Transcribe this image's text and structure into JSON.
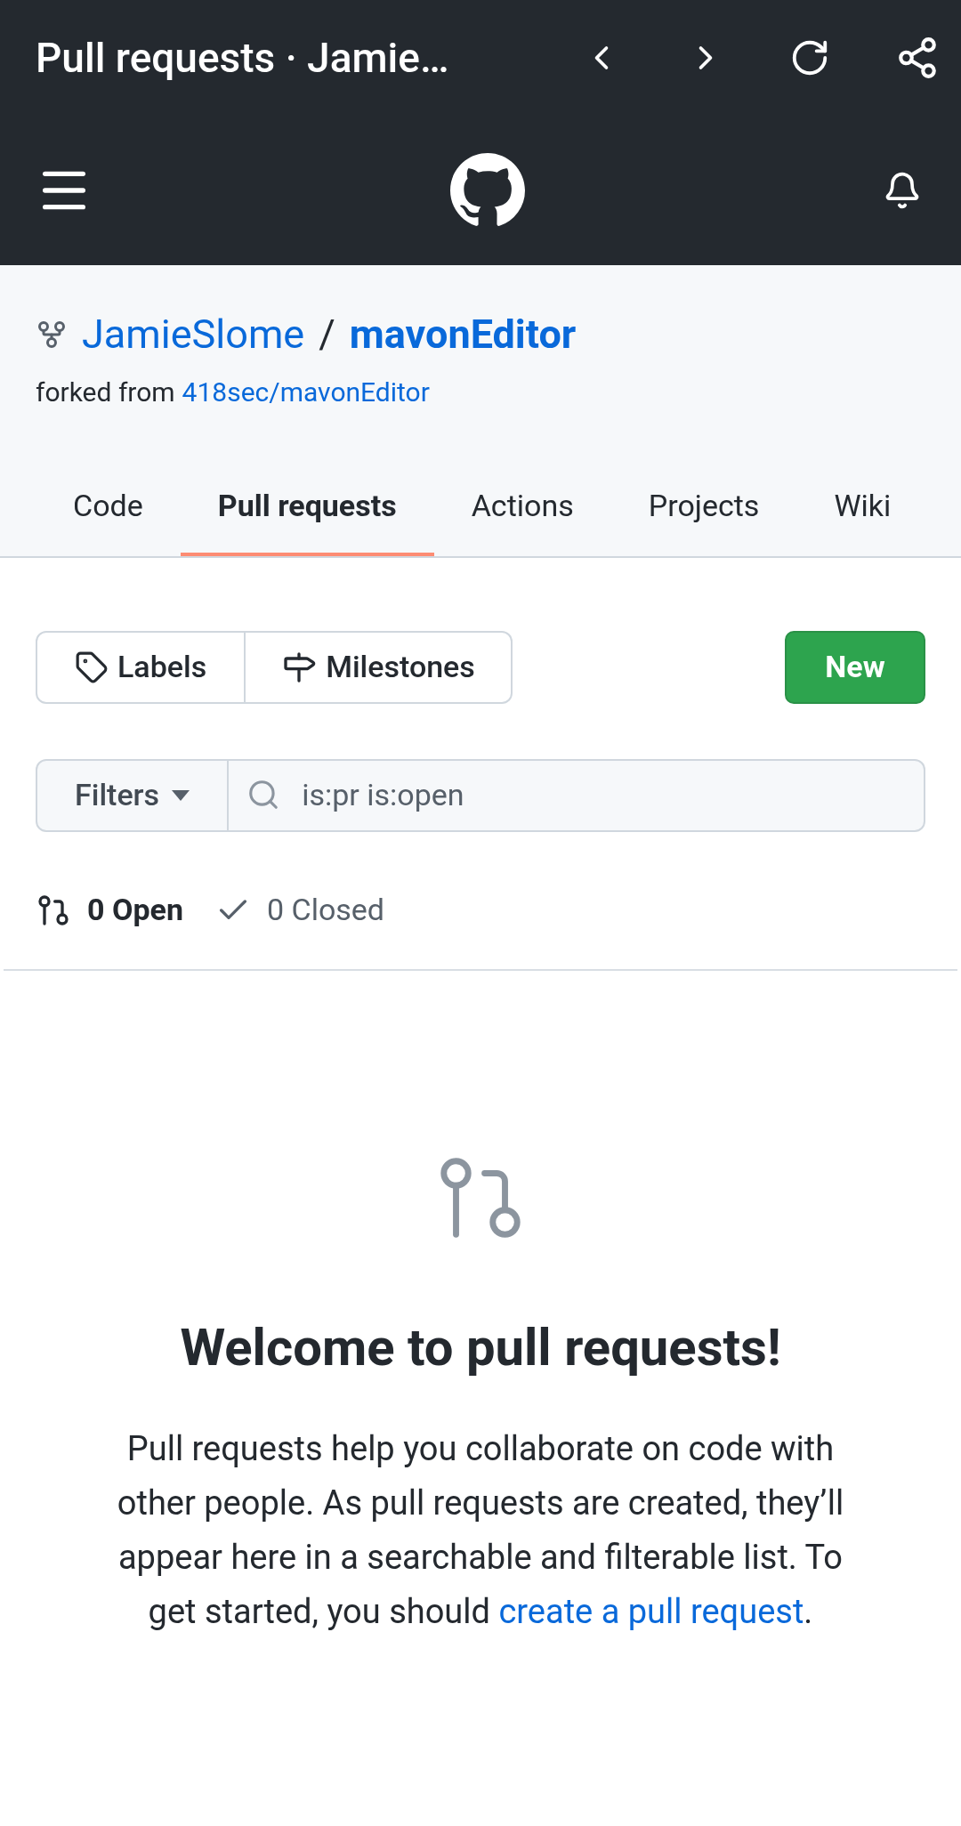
{
  "browser_bar": {
    "title": "Pull requests · Jamie…"
  },
  "repo": {
    "owner": "JamieSlome",
    "separator": "/",
    "name": "mavonEditor",
    "forked_label": "forked from",
    "forked_link": "418sec/mavonEditor"
  },
  "tabs": [
    {
      "label": "Code",
      "selected": false
    },
    {
      "label": "Pull requests",
      "selected": true
    },
    {
      "label": "Actions",
      "selected": false
    },
    {
      "label": "Projects",
      "selected": false
    },
    {
      "label": "Wiki",
      "selected": false
    }
  ],
  "labels_button": "Labels",
  "milestones_button": "Milestones",
  "new_button": "New",
  "filters_button": "Filters",
  "search": {
    "value": "is:pr is:open"
  },
  "states": [
    {
      "label": "0 Open",
      "selected": true
    },
    {
      "label": "0 Closed",
      "selected": false
    }
  ],
  "empty": {
    "heading": "Welcome to pull requests!",
    "text_before": "Pull requests help you collaborate on code with other people. As pull requests are created, they’ll appear here in a searchable and filterable list. To get started, you should ",
    "link": "create a pull request",
    "text_after": "."
  }
}
